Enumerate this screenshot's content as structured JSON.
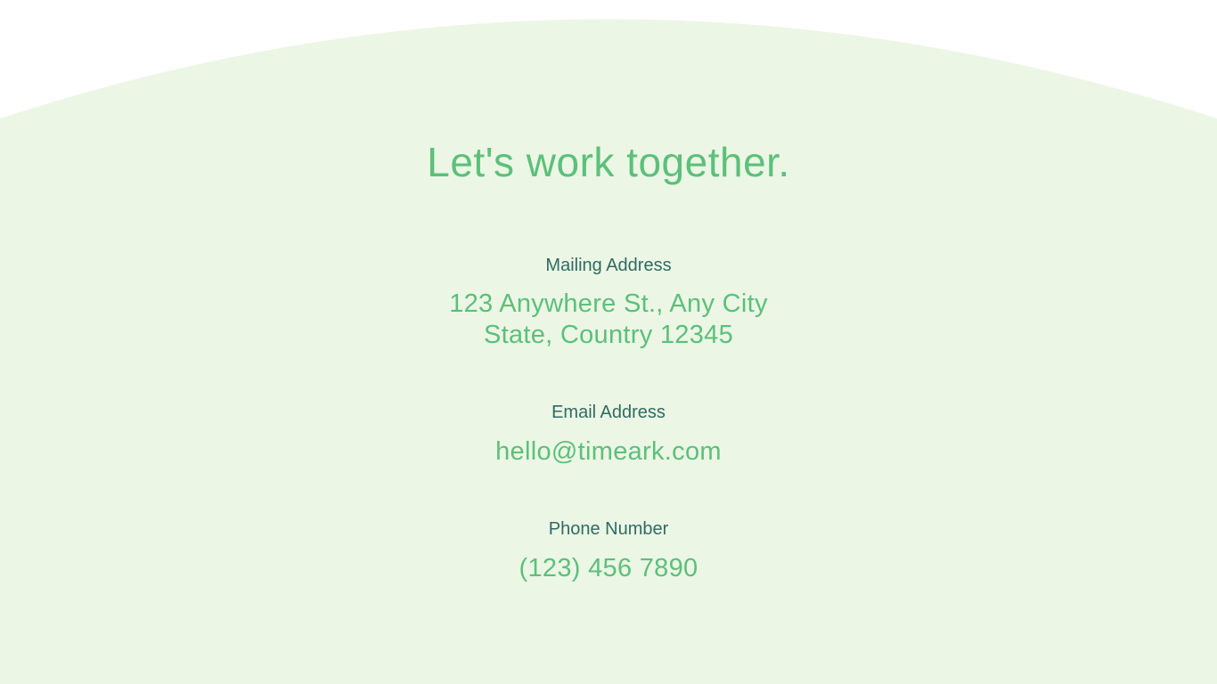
{
  "colors": {
    "background": "#ffffff",
    "arch_fill": "#ecf6e5",
    "accent_green": "#5cc07a",
    "label_teal": "#2f6b63"
  },
  "headline": "Let's work together.",
  "mailing": {
    "label": "Mailing Address",
    "line1": "123 Anywhere St., Any City",
    "line2": "State, Country 12345"
  },
  "email": {
    "label": "Email Address",
    "value": "hello@timeark.com"
  },
  "phone": {
    "label": "Phone Number",
    "value": "(123) 456 7890"
  }
}
